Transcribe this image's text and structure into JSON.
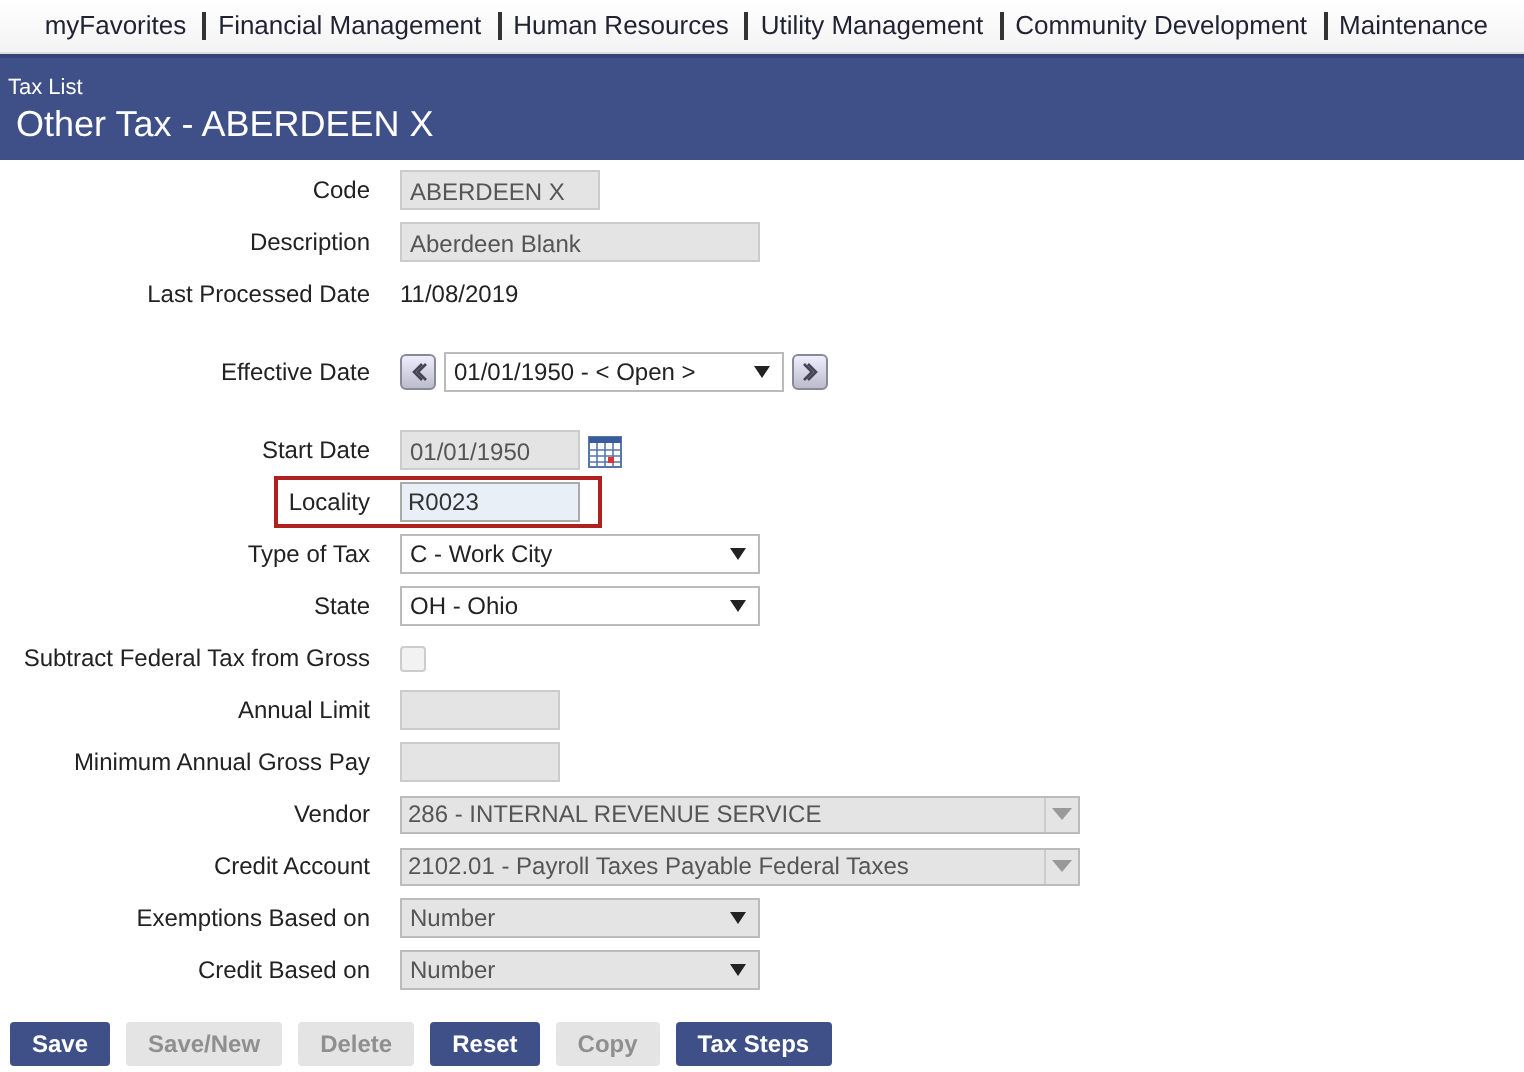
{
  "top_menu": [
    {
      "label": "myFavorites"
    },
    {
      "label": "Financial Management"
    },
    {
      "label": "Human Resources"
    },
    {
      "label": "Utility Management"
    },
    {
      "label": "Community Development"
    },
    {
      "label": "Maintenance"
    }
  ],
  "header": {
    "breadcrumb": "Tax List",
    "title": "Other Tax - ABERDEEN X"
  },
  "form_groups": [
    [
      {
        "label": "Code",
        "kind": "short-field",
        "value": "ABERDEEN X"
      },
      {
        "label": "Description",
        "kind": "long-field",
        "value": "Aberdeen Blank"
      },
      {
        "label": "Last Processed Date",
        "kind": "value",
        "value": "11/08/2019"
      }
    ],
    [
      {
        "label": "Effective Date",
        "kind": "nav-select",
        "value": "01/01/1950 - < Open >"
      }
    ],
    [
      {
        "label": "Start Date",
        "kind": "date-field",
        "value": "01/01/1950"
      },
      {
        "label": "Locality",
        "kind": "input",
        "value": "R0023",
        "highlighted": true
      },
      {
        "label": "Type of Tax",
        "kind": "select",
        "value": "C - Work City"
      },
      {
        "label": "State",
        "kind": "select",
        "value": "OH - Ohio"
      },
      {
        "label": "Subtract Federal Tax from Gross",
        "kind": "checkbox",
        "checked": false
      },
      {
        "label": "Annual Limit",
        "kind": "amount-field"
      },
      {
        "label": "Minimum Annual Gross Pay",
        "kind": "amount-field"
      },
      {
        "label": "Vendor",
        "kind": "combo",
        "value": "286 - INTERNAL REVENUE SERVICE"
      },
      {
        "label": "Credit Account",
        "kind": "combo",
        "value": "2102.01 - Payroll Taxes Payable Federal Taxes"
      },
      {
        "label": "Exemptions Based on",
        "kind": "disabled-select",
        "value": "Number"
      },
      {
        "label": "Credit Based on",
        "kind": "disabled-select",
        "value": "Number"
      }
    ]
  ],
  "buttons": [
    {
      "label": "Save",
      "disabled": false
    },
    {
      "label": "Save/New",
      "disabled": true
    },
    {
      "label": "Delete",
      "disabled": true
    },
    {
      "label": "Reset",
      "disabled": false
    },
    {
      "label": "Copy",
      "disabled": true
    },
    {
      "label": "Tax Steps",
      "disabled": false
    }
  ]
}
